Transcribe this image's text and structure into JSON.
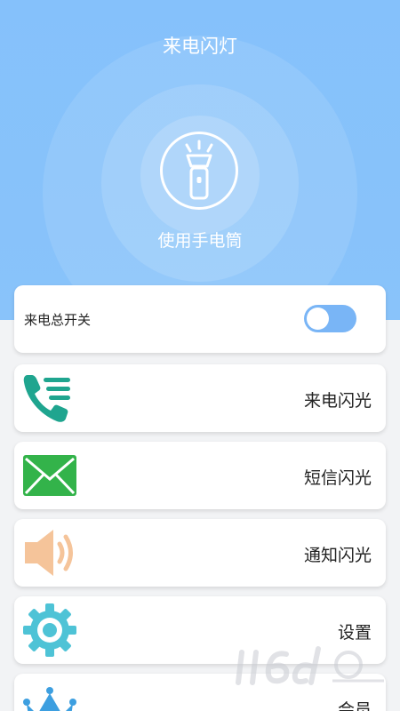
{
  "header": {
    "title": "来电闪灯"
  },
  "torch": {
    "label": "使用手电筒",
    "icon": "flashlight-icon"
  },
  "master_switch": {
    "label": "来电总开关",
    "state": "on"
  },
  "features": [
    {
      "label": "来电闪光",
      "icon": "phone-call-icon",
      "color": "#1fa58f"
    },
    {
      "label": "短信闪光",
      "icon": "envelope-icon",
      "color": "#33b34a"
    },
    {
      "label": "通知闪光",
      "icon": "speaker-icon",
      "color": "#f5c49a"
    },
    {
      "label": "设置",
      "icon": "gear-icon",
      "color": "#4ec3d6"
    },
    {
      "label": "会员",
      "icon": "crown-icon",
      "color": "#3d9fe0"
    }
  ],
  "colors": {
    "hero": "#87c2fb",
    "toggle": "#79b5f6",
    "card": "#ffffff"
  }
}
